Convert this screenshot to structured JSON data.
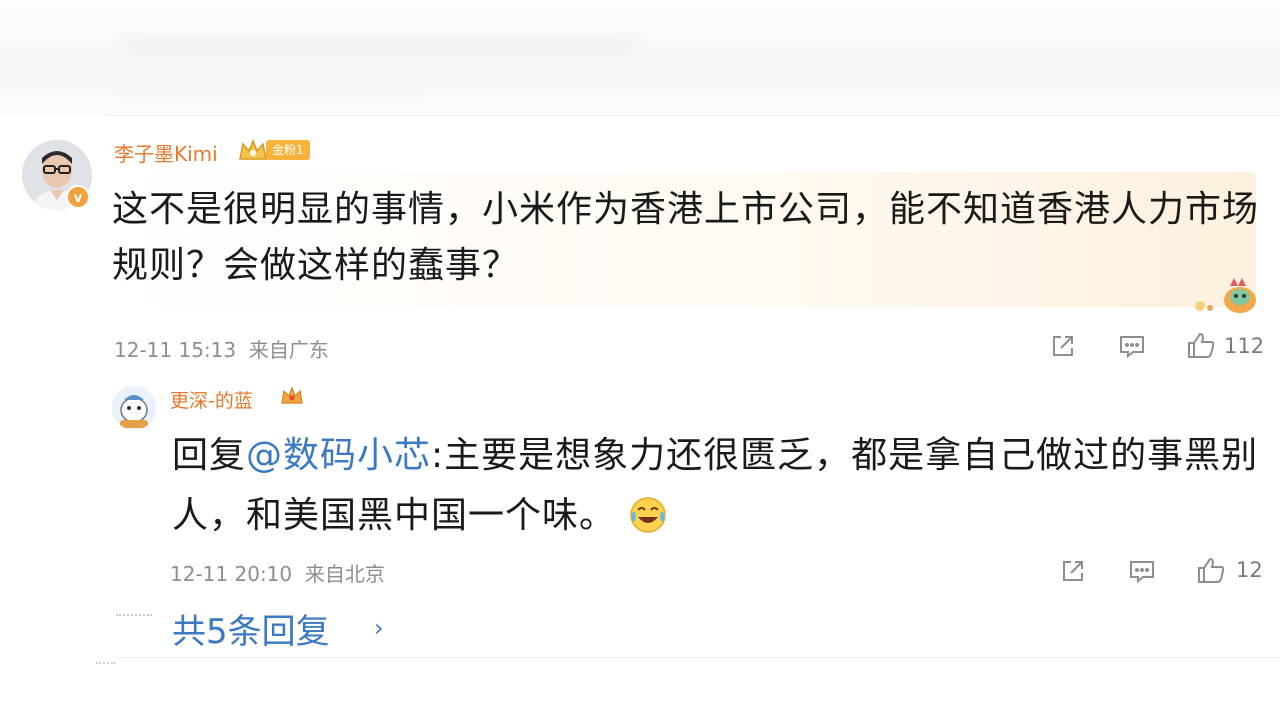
{
  "comment": {
    "username": "李子墨Kimi",
    "fan_badge": "金粉1",
    "text": "这不是很明显的事情，小米作为香港上市公司，能不知道香港人力市场规则？会做这样的蠢事？",
    "timestamp": "12-11 15:13",
    "location": "来自广东",
    "like_count": "112"
  },
  "reply": {
    "username": "更深-的蓝",
    "prefix": "回复",
    "mention": "@数码小芯",
    "text": ":主要是想象力还很匮乏，都是拿自己做过的事黑别人，和美国黑中国一个味。",
    "timestamp": "12-11 20:10",
    "location": "来自北京",
    "like_count": "12"
  },
  "more_replies": {
    "label": "共5条回复",
    "chevron": "›"
  },
  "colors": {
    "username": "#e8782a",
    "link": "#3b79c2",
    "meta": "#8e8e8e"
  },
  "icons": [
    "share-icon",
    "comment-icon",
    "like-icon",
    "crown-icon",
    "verified-icon",
    "laugh-cry-emoji-icon"
  ]
}
